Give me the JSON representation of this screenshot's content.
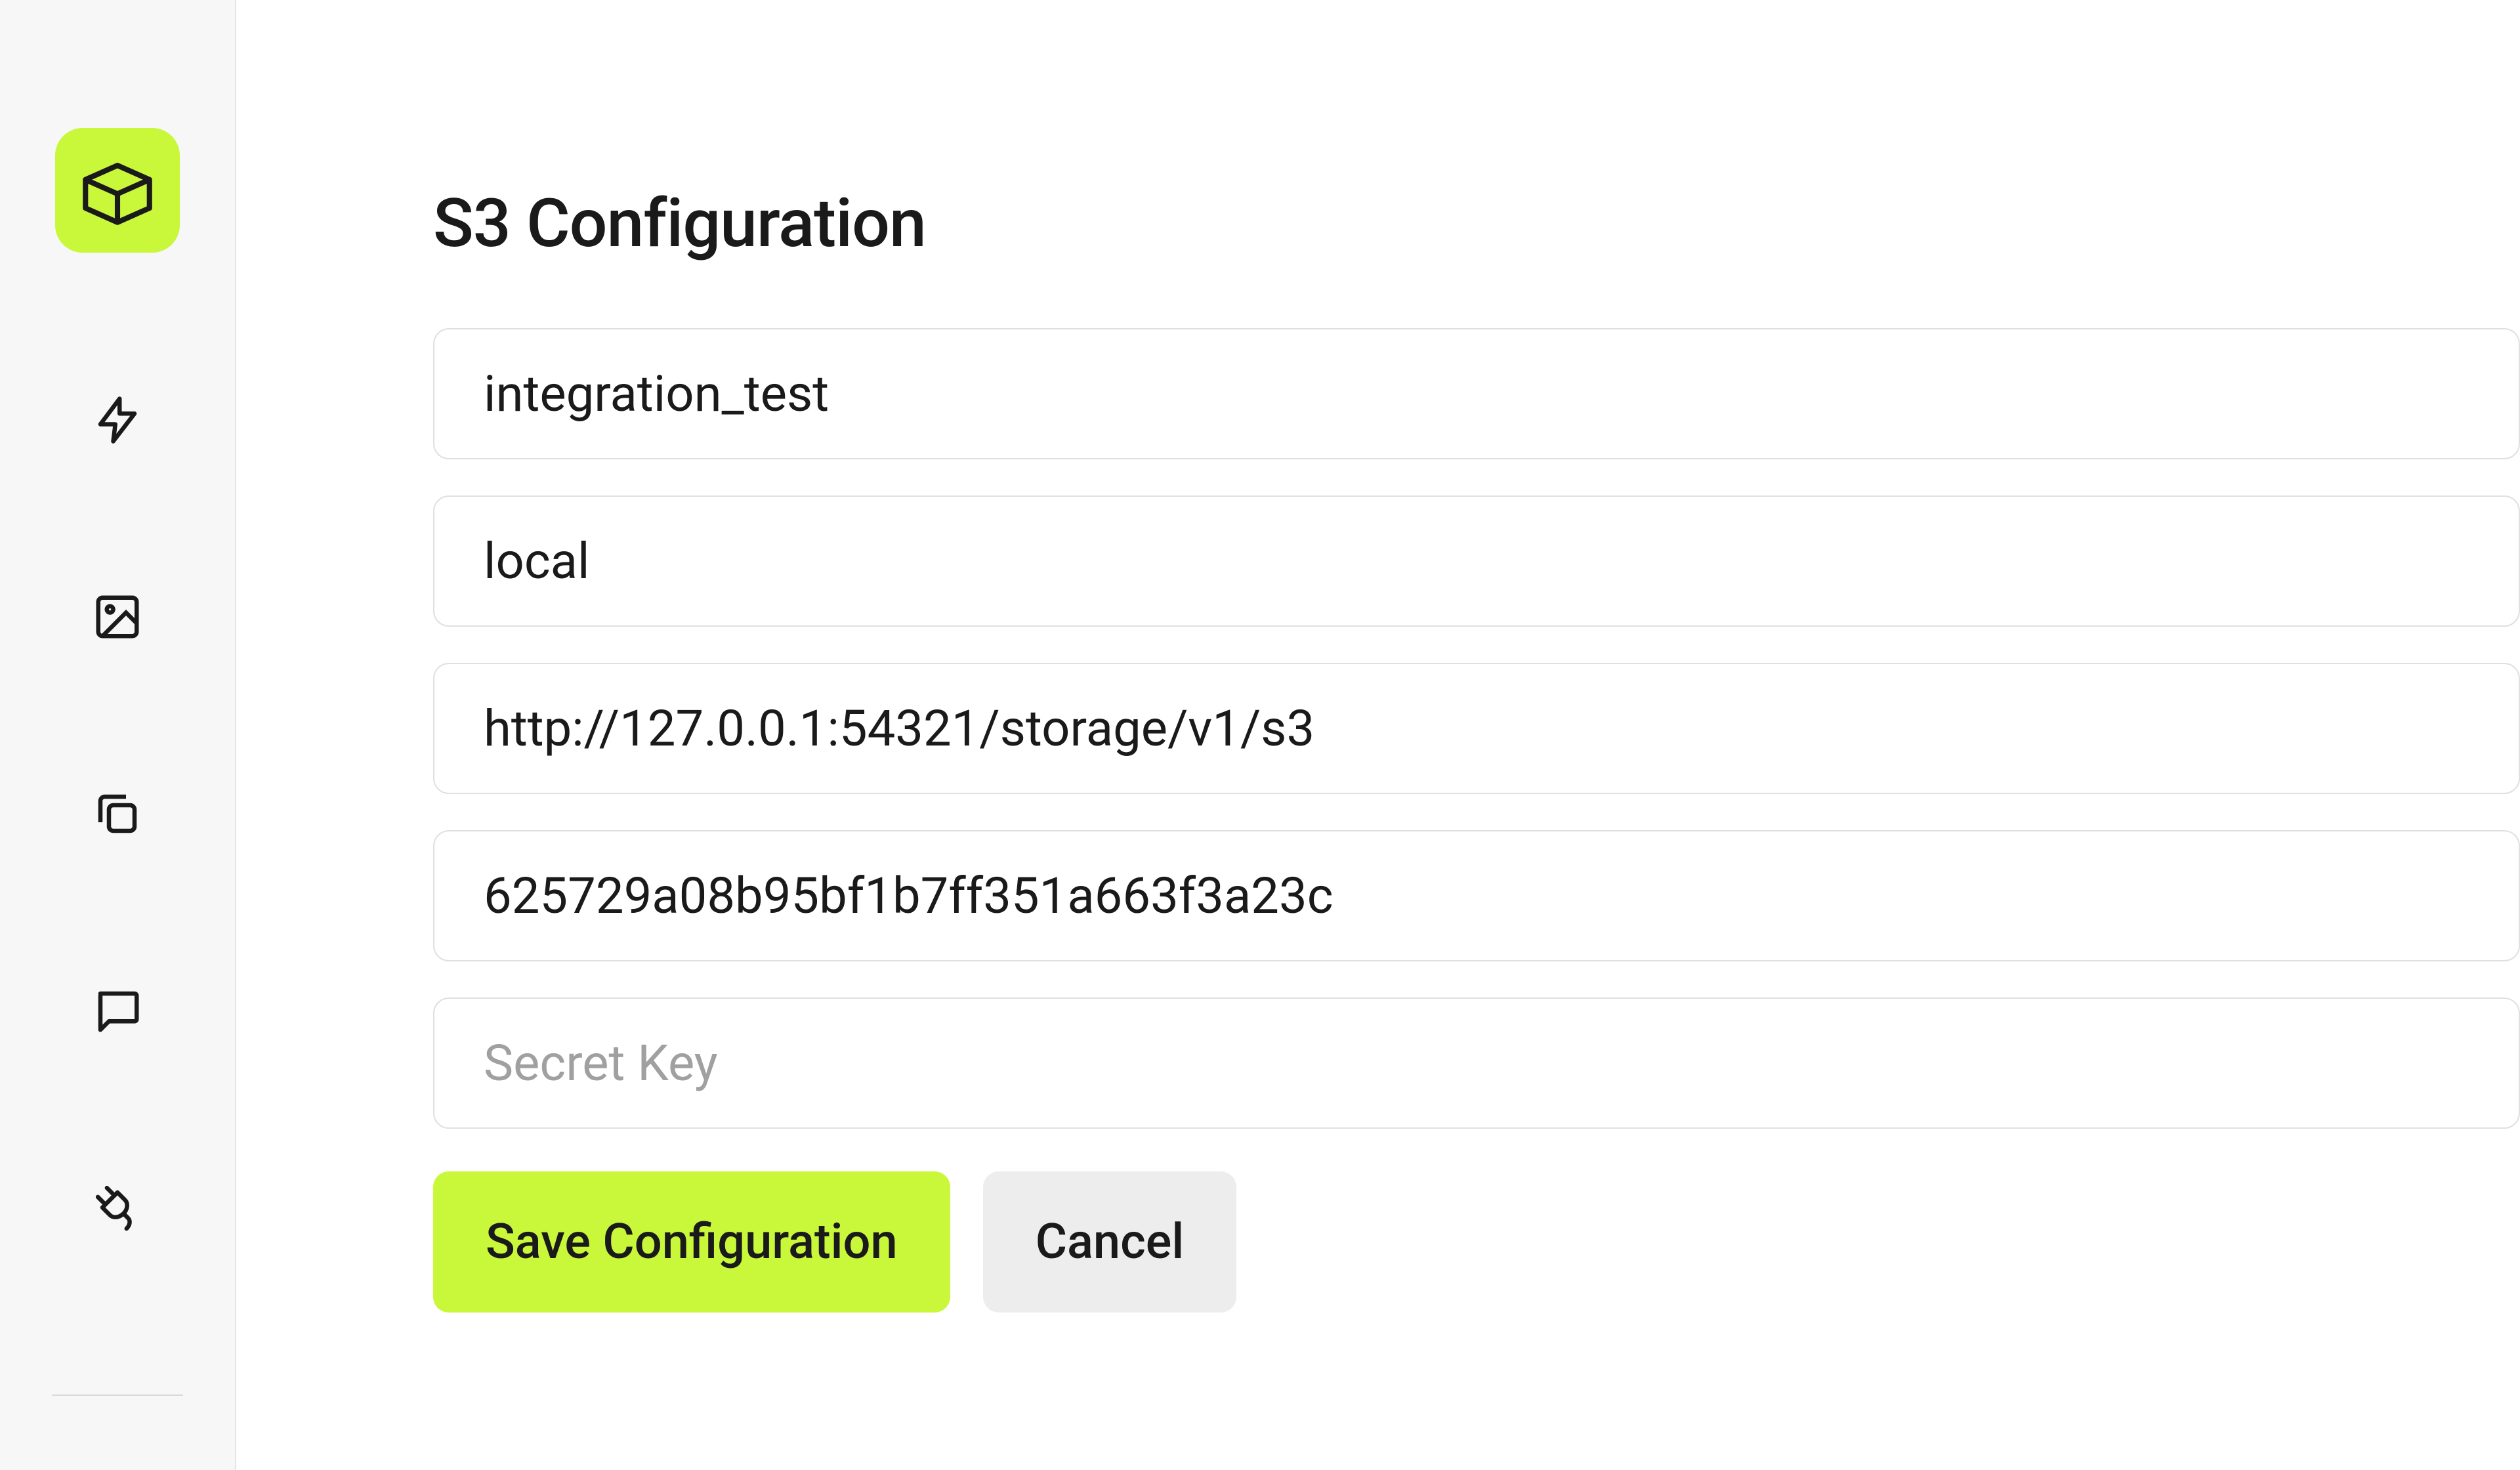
{
  "sidebar": {
    "logo_name": "cube-logo"
  },
  "main": {
    "title": "S3 Configuration",
    "fields": {
      "bucket": {
        "value": "integration_test",
        "placeholder": ""
      },
      "region": {
        "value": "local",
        "placeholder": ""
      },
      "endpoint": {
        "value": "http://127.0.0.1:54321/storage/v1/s3",
        "placeholder": ""
      },
      "access_key": {
        "value": "625729a08b95bf1b7ff351a663f3a23c",
        "placeholder": ""
      },
      "secret_key": {
        "value": "",
        "placeholder": "Secret Key"
      }
    },
    "buttons": {
      "save": "Save Configuration",
      "cancel": "Cancel"
    }
  },
  "colors": {
    "accent": "#c9f73a",
    "text": "#1a1a1a",
    "border": "#e0e0e0",
    "sidebar_bg": "#f7f7f7",
    "secondary_btn": "#ededed"
  }
}
